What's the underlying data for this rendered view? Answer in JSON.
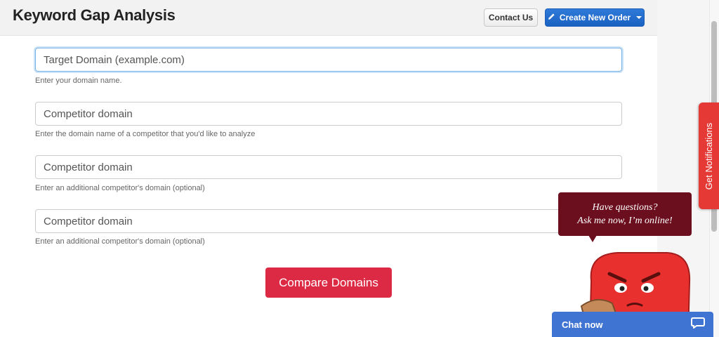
{
  "header": {
    "title": "Keyword Gap Analysis",
    "contact_label": "Contact Us",
    "order_label": "Create New Order"
  },
  "form": {
    "fields": [
      {
        "placeholder": "Target Domain (example.com)",
        "help": "Enter your domain name."
      },
      {
        "placeholder": "Competitor domain",
        "help": "Enter the domain name of a competitor that you'd like to analyze"
      },
      {
        "placeholder": "Competitor domain",
        "help": "Enter an additional competitor's domain (optional)"
      },
      {
        "placeholder": "Competitor domain",
        "help": "Enter an additional competitor's domain (optional)"
      }
    ],
    "submit_label": "Compare Domains"
  },
  "widgets": {
    "notifications_label": "Get Notifications",
    "bubble_line1": "Have questions?",
    "bubble_line2": "Ask me now, I’m online!",
    "chat_label": "Chat now"
  },
  "colors": {
    "accent_blue": "#1a62c2",
    "compare_red": "#dc2a44",
    "notif_red": "#e53935",
    "bubble_maroon": "#6b0e1e",
    "chat_blue": "#3f74d3"
  },
  "icons": {
    "order": "pencil-icon",
    "chat": "chat-bubble-icon"
  }
}
